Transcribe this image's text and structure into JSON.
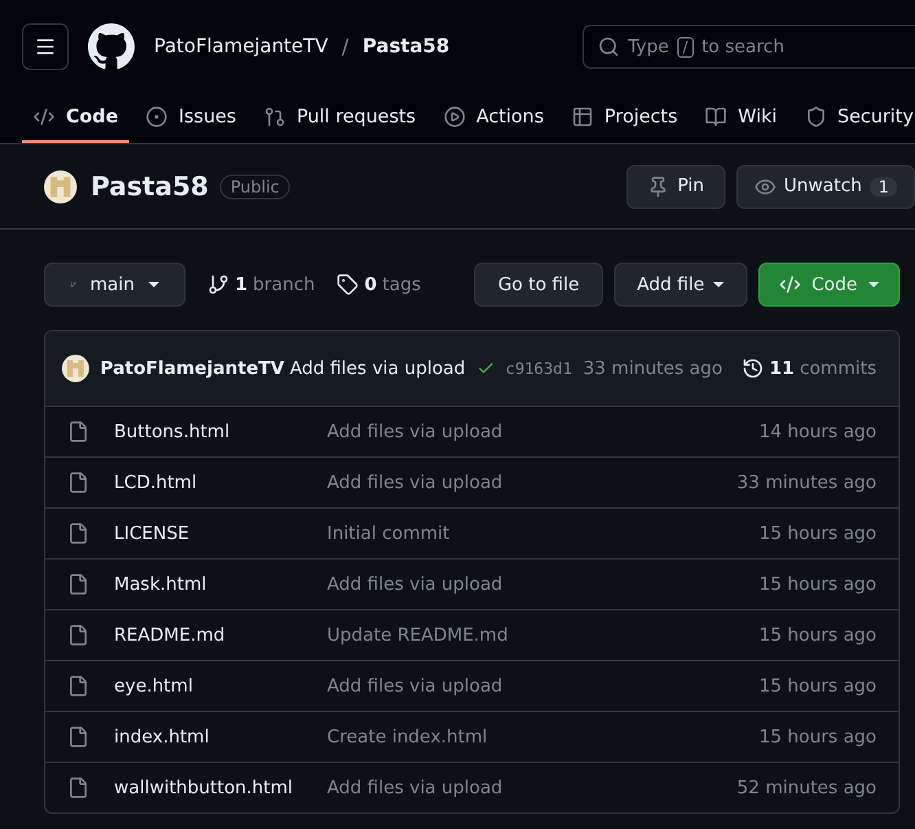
{
  "header": {
    "owner": "PatoFlamejanteTV",
    "separator": "/",
    "repo": "Pasta58",
    "search": {
      "before": "Type",
      "key": "/",
      "after": "to search"
    }
  },
  "tabs": [
    {
      "label": "Code",
      "selected": true
    },
    {
      "label": "Issues",
      "selected": false
    },
    {
      "label": "Pull requests",
      "selected": false
    },
    {
      "label": "Actions",
      "selected": false
    },
    {
      "label": "Projects",
      "selected": false
    },
    {
      "label": "Wiki",
      "selected": false
    },
    {
      "label": "Security",
      "selected": false
    }
  ],
  "repo": {
    "name": "Pasta58",
    "visibility": "Public",
    "pin": "Pin",
    "watch": "Unwatch",
    "watch_count": "1"
  },
  "toolbar": {
    "branch": "main",
    "branches_count": "1",
    "branches_label": "branch",
    "tags_count": "0",
    "tags_label": "tags",
    "go_to_file": "Go to file",
    "add_file": "Add file",
    "code": "Code"
  },
  "commit": {
    "author": "PatoFlamejanteTV",
    "message": "Add files via upload",
    "hash": "c9163d1",
    "time": "33 minutes ago",
    "commits_count": "11",
    "commits_label": "commits"
  },
  "files": [
    {
      "name": "Buttons.html",
      "message": "Add files via upload",
      "time": "14 hours ago"
    },
    {
      "name": "LCD.html",
      "message": "Add files via upload",
      "time": "33 minutes ago"
    },
    {
      "name": "LICENSE",
      "message": "Initial commit",
      "time": "15 hours ago"
    },
    {
      "name": "Mask.html",
      "message": "Add files via upload",
      "time": "15 hours ago"
    },
    {
      "name": "README.md",
      "message": "Update README.md",
      "time": "15 hours ago"
    },
    {
      "name": "eye.html",
      "message": "Add files via upload",
      "time": "15 hours ago"
    },
    {
      "name": "index.html",
      "message": "Create index.html",
      "time": "15 hours ago"
    },
    {
      "name": "wallwithbutton.html",
      "message": "Add files via upload",
      "time": "52 minutes ago"
    }
  ]
}
